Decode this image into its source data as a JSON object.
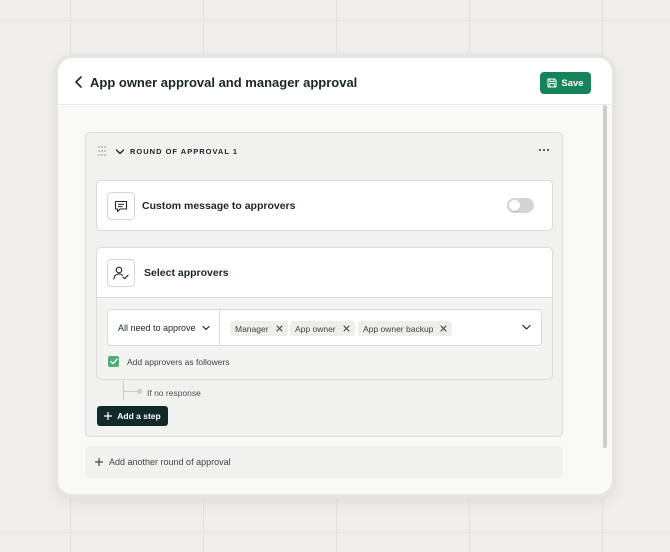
{
  "header": {
    "title": "App owner approval and manager approval",
    "save_label": "Save"
  },
  "round": {
    "label": "ROUND OF APPROVAL 1"
  },
  "custom_message": {
    "label": "Custom message to approvers",
    "enabled": false
  },
  "approvers": {
    "label": "Select approvers",
    "mode": "All need to approve",
    "chips": [
      "Manager",
      "App owner",
      "App owner backup"
    ],
    "add_as_followers_label": "Add approvers as followers",
    "add_as_followers_checked": true
  },
  "fallback": {
    "label": "If no response"
  },
  "add_step_label": "Add a step",
  "add_round_label": "Add another round of approval",
  "colors": {
    "primary": "#16845b",
    "dark_button": "#0f2a28",
    "checkbox": "#4eae76"
  }
}
